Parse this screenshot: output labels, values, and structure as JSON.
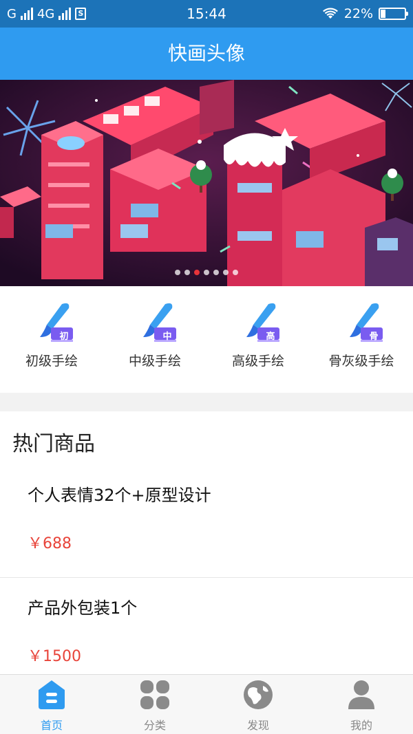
{
  "status_bar": {
    "carrier": "G",
    "network": "4G",
    "sim_label": "S",
    "time": "15:44",
    "battery": "22%",
    "battery_level": 0.22
  },
  "header": {
    "title": "快画头像"
  },
  "banner": {
    "slide_count": 7,
    "active_index": 2
  },
  "categories": [
    {
      "label": "初级手绘",
      "badge": "初",
      "icon": "brush-icon"
    },
    {
      "label": "中级手绘",
      "badge": "中",
      "icon": "brush-icon"
    },
    {
      "label": "高级手绘",
      "badge": "高",
      "icon": "brush-icon"
    },
    {
      "label": "骨灰级手绘",
      "badge": "骨",
      "icon": "brush-icon"
    }
  ],
  "hot": {
    "title": "热门商品",
    "products": [
      {
        "name": "个人表情32个+原型设计",
        "price": "￥688"
      },
      {
        "name": "产品外包装1个",
        "price": "￥1500"
      }
    ]
  },
  "nav": {
    "items": [
      {
        "label": "首页",
        "icon": "home-icon",
        "active": true
      },
      {
        "label": "分类",
        "icon": "category-grid-icon",
        "active": false
      },
      {
        "label": "发现",
        "icon": "globe-icon",
        "active": false
      },
      {
        "label": "我的",
        "icon": "user-icon",
        "active": false
      }
    ]
  },
  "colors": {
    "status_bar": "#1c73b8",
    "title_bar": "#2f9bf0",
    "accent": "#2f9bf0",
    "price": "#e8443a",
    "nav_inactive": "#888888"
  }
}
